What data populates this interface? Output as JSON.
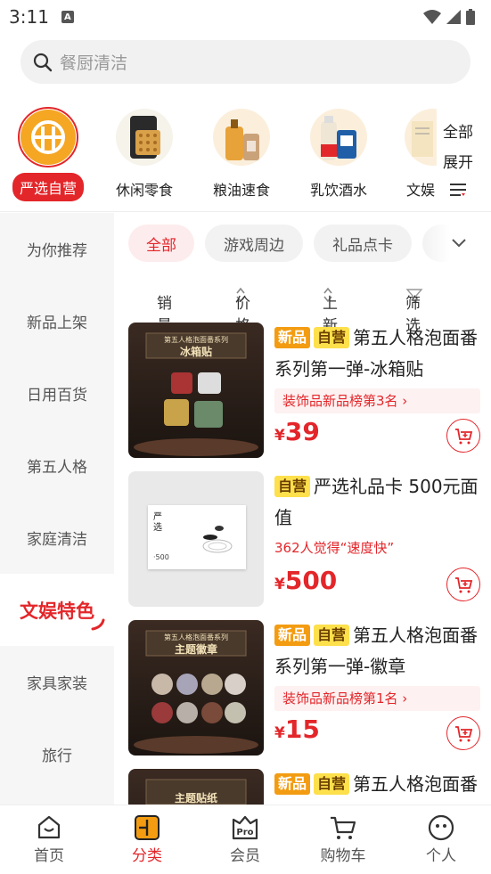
{
  "status_bar": {
    "time": "3:11"
  },
  "search": {
    "placeholder": "餐厨清洁"
  },
  "categories": [
    {
      "label": "严选自营",
      "active": true
    },
    {
      "label": "休闲零食"
    },
    {
      "label": "粮油速食"
    },
    {
      "label": "乳饮酒水"
    },
    {
      "label": "文娱"
    }
  ],
  "expand": {
    "line1": "全部",
    "line2": "展开"
  },
  "sidebar": {
    "items": [
      {
        "label": "为你推荐"
      },
      {
        "label": "新品上架"
      },
      {
        "label": "日用百货"
      },
      {
        "label": "第五人格"
      },
      {
        "label": "家庭清洁"
      },
      {
        "label": "文娱特色",
        "active": true
      },
      {
        "label": "家具家装"
      },
      {
        "label": "旅行"
      }
    ]
  },
  "filter_tabs": [
    {
      "label": "全部",
      "active": true
    },
    {
      "label": "游戏周边"
    },
    {
      "label": "礼品点卡"
    }
  ],
  "sort": {
    "sales": "销量",
    "price": "价格",
    "newest": "上新",
    "filter": "筛选"
  },
  "products": [
    {
      "tag_new": "新品",
      "tag_self": "自营",
      "title": "第五人格泡面番系列第一弹-冰箱贴",
      "note": "装饰品新品榜第3名 ›",
      "price_symbol": "¥",
      "price": "39",
      "img_caption": "冰箱贴",
      "img_top": "第五人格泡面番系列"
    },
    {
      "tag_self": "自营",
      "title": "严选礼品卡 500元面值",
      "note": "362人觉得“速度快”",
      "price_symbol": "¥",
      "price": "500",
      "card_text1": "严",
      "card_text2": "选",
      "card_value": "500"
    },
    {
      "tag_new": "新品",
      "tag_self": "自营",
      "title": "第五人格泡面番系列第一弹-徽章",
      "note": "装饰品新品榜第1名 ›",
      "price_symbol": "¥",
      "price": "15",
      "img_caption": "主题徽章",
      "img_top": "第五人格泡面番系列"
    },
    {
      "tag_new": "新品",
      "tag_self": "自营",
      "title": "第五人格泡面番系列第一弹",
      "img_caption": "主题贴纸"
    }
  ],
  "tabbar": [
    {
      "label": "首页"
    },
    {
      "label": "分类",
      "active": true
    },
    {
      "label": "会员"
    },
    {
      "label": "购物车"
    },
    {
      "label": "个人"
    }
  ],
  "colors": {
    "accent": "#e3262a",
    "tag_new": "#f39c12",
    "tag_self": "#fde04b"
  }
}
